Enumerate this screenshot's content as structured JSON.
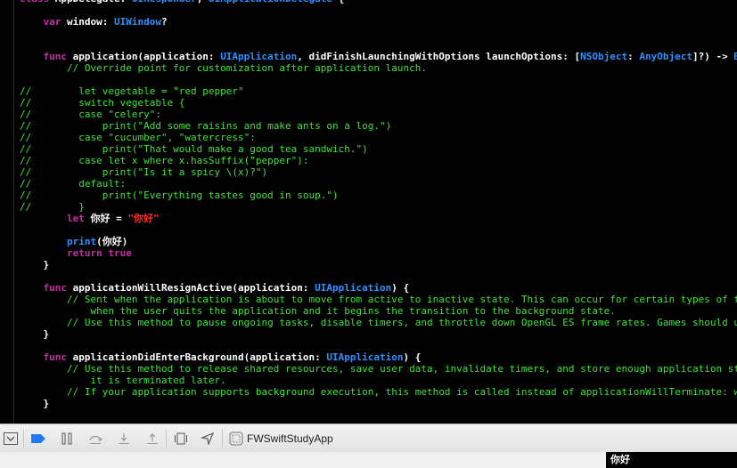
{
  "editor": {
    "lines": [
      [
        {
          "t": "class ",
          "c": "keyword"
        },
        {
          "t": "AppDelegate: ",
          "c": "plain"
        },
        {
          "t": "UIResponder",
          "c": "type"
        },
        {
          "t": ", ",
          "c": "plain"
        },
        {
          "t": "UIApplicationDelegate",
          "c": "type"
        },
        {
          "t": " {",
          "c": "plain"
        }
      ],
      [],
      [
        {
          "t": "    var ",
          "c": "keyword"
        },
        {
          "t": "window: ",
          "c": "plain"
        },
        {
          "t": "UIWindow",
          "c": "type"
        },
        {
          "t": "?",
          "c": "plain"
        }
      ],
      [],
      [],
      [
        {
          "t": "    func ",
          "c": "keyword"
        },
        {
          "t": "application(application: ",
          "c": "plain"
        },
        {
          "t": "UIApplication",
          "c": "type"
        },
        {
          "t": ", didFinishLaunchingWithOptions launchOptions: [",
          "c": "plain"
        },
        {
          "t": "NSObject",
          "c": "type"
        },
        {
          "t": ": ",
          "c": "plain"
        },
        {
          "t": "AnyObject",
          "c": "type"
        },
        {
          "t": "]?) -> ",
          "c": "plain"
        },
        {
          "t": "B",
          "c": "type"
        }
      ],
      [
        {
          "t": "        // Override point for customization after application launch.",
          "c": "comment"
        }
      ],
      [],
      [
        {
          "t": "//        let vegetable = \"red pepper\"",
          "c": "comment"
        }
      ],
      [
        {
          "t": "//        switch vegetable {",
          "c": "comment"
        }
      ],
      [
        {
          "t": "//        case \"celery\":",
          "c": "comment"
        }
      ],
      [
        {
          "t": "//            print(\"Add some raisins and make ants on a log.\")",
          "c": "comment"
        }
      ],
      [
        {
          "t": "//        case \"cucumber\", \"watercress\":",
          "c": "comment"
        }
      ],
      [
        {
          "t": "//            print(\"That would make a good tea sandwich.\")",
          "c": "comment"
        }
      ],
      [
        {
          "t": "//        case let x where x.hasSuffix(\"pepper\"):",
          "c": "comment"
        }
      ],
      [
        {
          "t": "//            print(\"Is it a spicy \\(x)?\")",
          "c": "comment"
        }
      ],
      [
        {
          "t": "//        default:",
          "c": "comment"
        }
      ],
      [
        {
          "t": "//            print(\"Everything tastes good in soup.\")",
          "c": "comment"
        }
      ],
      [
        {
          "t": "//        }",
          "c": "comment"
        }
      ],
      [
        {
          "t": "        let ",
          "c": "keyword"
        },
        {
          "t": "你好 = ",
          "c": "plain"
        },
        {
          "t": "\"你好\"",
          "c": "string"
        }
      ],
      [],
      [
        {
          "t": "        print",
          "c": "type"
        },
        {
          "t": "(你好)",
          "c": "plain"
        }
      ],
      [
        {
          "t": "        return ",
          "c": "keyword"
        },
        {
          "t": "true",
          "c": "keyword"
        }
      ],
      [
        {
          "t": "    }",
          "c": "plain"
        }
      ],
      [],
      [
        {
          "t": "    func ",
          "c": "keyword"
        },
        {
          "t": "applicationWillResignActive(application: ",
          "c": "plain"
        },
        {
          "t": "UIApplication",
          "c": "type"
        },
        {
          "t": ") {",
          "c": "plain"
        }
      ],
      [
        {
          "t": "        // Sent when the application is about to move from active to inactive state. This can occur for certain types of t",
          "c": "comment"
        }
      ],
      [
        {
          "t": "            when the user quits the application and it begins the transition to the background state.",
          "c": "comment"
        }
      ],
      [
        {
          "t": "        // Use this method to pause ongoing tasks, disable timers, and throttle down OpenGL ES frame rates. Games should u",
          "c": "comment"
        }
      ],
      [
        {
          "t": "    }",
          "c": "plain"
        }
      ],
      [],
      [
        {
          "t": "    func ",
          "c": "keyword"
        },
        {
          "t": "applicationDidEnterBackground(application: ",
          "c": "plain"
        },
        {
          "t": "UIApplication",
          "c": "type"
        },
        {
          "t": ") {",
          "c": "plain"
        }
      ],
      [
        {
          "t": "        // Use this method to release shared resources, save user data, invalidate timers, and store enough application st",
          "c": "comment"
        }
      ],
      [
        {
          "t": "            it is terminated later.",
          "c": "comment"
        }
      ],
      [
        {
          "t": "        // If your application supports background execution, this method is called instead of applicationWillTerminate: w",
          "c": "comment"
        }
      ],
      [
        {
          "t": "    }",
          "c": "plain"
        }
      ]
    ]
  },
  "debug_bar": {
    "icons": [
      "hide-debug-area-icon",
      "breakpoint-toggle-icon",
      "pause-continue-icon",
      "step-over-icon",
      "step-into-icon",
      "step-out-icon",
      "view-hierarchy-icon",
      "simulate-location-icon",
      "app-target-icon"
    ],
    "target_label": "FWSwiftStudyApp"
  },
  "tooltip": {
    "text": "你好"
  },
  "colors": {
    "keyword": "#c42fa3",
    "type": "#2f91ff",
    "comment": "#3fe33a",
    "string": "#ff2c2c",
    "plain": "#ffffff",
    "breakpoint": "#1f7cf2"
  }
}
